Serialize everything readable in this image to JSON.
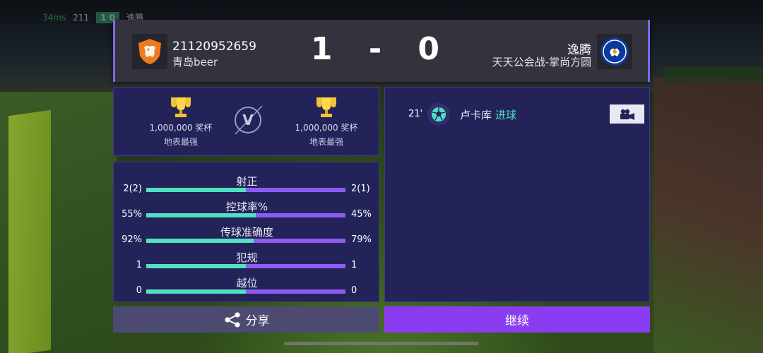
{
  "status": {
    "ping": "34ms",
    "mini_score_left": "211",
    "mini_score": "1 0",
    "mini_name": "逸腾"
  },
  "header": {
    "home": {
      "name": "21120952659",
      "club": "青岛beer"
    },
    "score": "1 - 0",
    "away": {
      "name": "逸腾",
      "club": "天天公会战-掌尚方圆"
    }
  },
  "trophies": {
    "home": {
      "amount": "1,000,000 奖杯",
      "rank": "地表最强"
    },
    "vs": "V",
    "away": {
      "amount": "1,000,000 奖杯",
      "rank": "地表最强"
    }
  },
  "stats": [
    {
      "label": "射正",
      "home": "2(2)",
      "away": "2(1)",
      "home_pct": 50
    },
    {
      "label": "控球率%",
      "home": "55%",
      "away": "45%",
      "home_pct": 55
    },
    {
      "label": "传球准确度",
      "home": "92%",
      "away": "79%",
      "home_pct": 54
    },
    {
      "label": "犯规",
      "home": "1",
      "away": "1",
      "home_pct": 50
    },
    {
      "label": "越位",
      "home": "0",
      "away": "0",
      "home_pct": 50
    }
  ],
  "events": [
    {
      "minute": "21'",
      "player": "卢卡库",
      "type": "进球",
      "icon": "soccer-ball-icon"
    }
  ],
  "buttons": {
    "share": "分享",
    "continue": "继续"
  },
  "colors": {
    "home_bar": "#52e0c0",
    "away_bar": "#8c5cf0",
    "continue": "#8a3df0",
    "panel": "#23235a"
  }
}
